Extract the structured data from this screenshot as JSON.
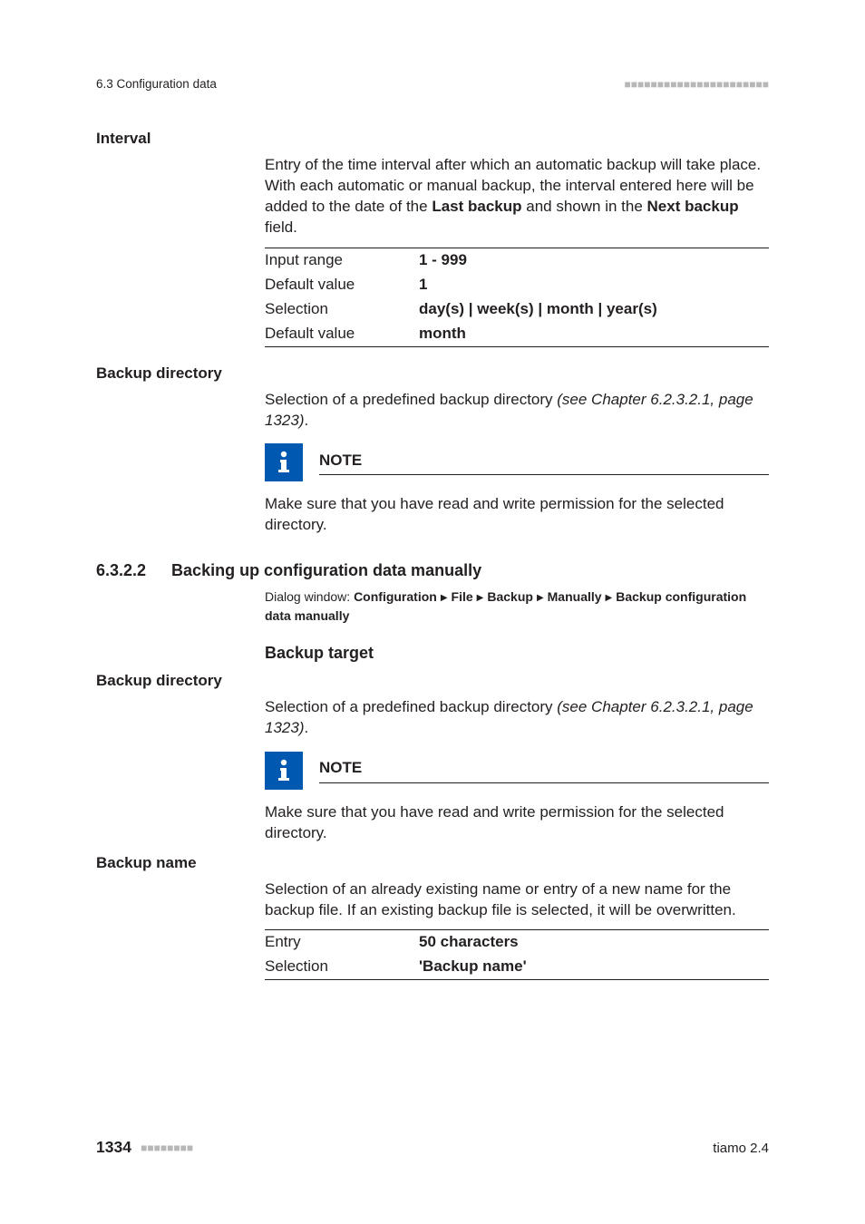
{
  "runningHeader": {
    "left": "6.3 Configuration data"
  },
  "footer": {
    "pageNumber": "1334",
    "product": "tiamo 2.4"
  },
  "interval": {
    "heading": "Interval",
    "para_pre": "Entry of the time interval after which an automatic backup will take place. With each automatic or manual backup, the interval entered here will be added to the date of the ",
    "para_lb": "Last backup",
    "para_mid": " and shown in the ",
    "para_nb": "Next backup",
    "para_post": " field.",
    "rows": [
      {
        "k": "Input range",
        "v": "1 - 999"
      },
      {
        "k": "Default value",
        "v": "1"
      },
      {
        "k": "Selection",
        "v": "day(s) | week(s) | month | year(s)"
      },
      {
        "k": "Default value",
        "v": "month"
      }
    ]
  },
  "bdir1": {
    "heading": "Backup directory",
    "para_pre": "Selection of a predefined backup directory ",
    "para_ref": "(see Chapter 6.2.3.2.1, page 1323)",
    "para_post": ".",
    "noteLabel": "NOTE",
    "noteBody": "Make sure that you have read and write permission for the selected directory."
  },
  "sec": {
    "num": "6.3.2.2",
    "title": "Backing up configuration data manually",
    "dlgLabel": "Dialog window: ",
    "dlgParts": [
      "Configuration",
      "File",
      "Backup",
      "Manually",
      "Backup configuration data manually"
    ]
  },
  "target": {
    "heading": "Backup target"
  },
  "bdir2": {
    "heading": "Backup directory",
    "para_pre": "Selection of a predefined backup directory ",
    "para_ref": "(see Chapter 6.2.3.2.1, page 1323)",
    "para_post": ".",
    "noteLabel": "NOTE",
    "noteBody": "Make sure that you have read and write permission for the selected directory."
  },
  "bname": {
    "heading": "Backup name",
    "para": "Selection of an already existing name or entry of a new name for the backup file. If an existing backup file is selected, it will be overwritten.",
    "rows": [
      {
        "k": "Entry",
        "v": "50 characters"
      },
      {
        "k": "Selection",
        "v": "'Backup name'"
      }
    ]
  }
}
